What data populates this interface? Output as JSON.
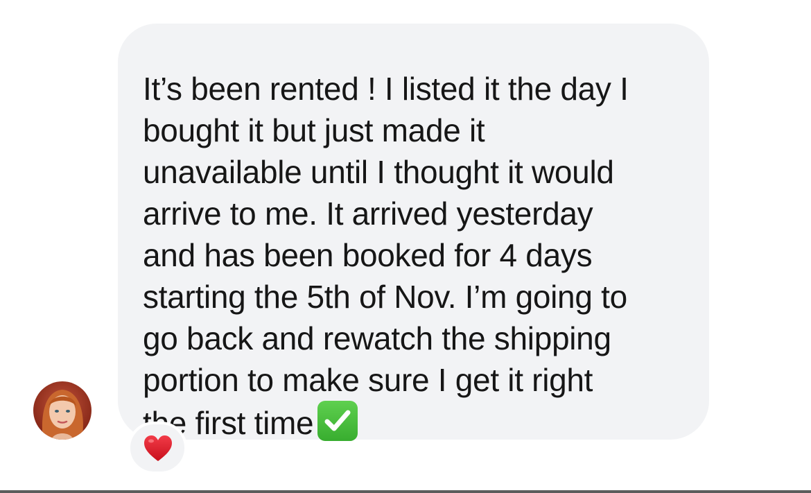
{
  "message": {
    "lines": [
      "It’s been rented ! I listed it the day I",
      "bought it but just made it",
      "unavailable until I thought it would",
      "arrive to me. It arrived yesterday",
      "and has been booked for 4 days",
      "starting the 5th of Nov. I’m going to",
      "go back and rewatch the shipping",
      "portion to make sure I get it right",
      "the first time"
    ],
    "trailing_emoji": "check-mark-button-icon",
    "bubble_color": "#f2f3f5",
    "text_color": "#161616"
  },
  "sender": {
    "avatar": "avatar-icon"
  },
  "reaction": {
    "emoji": "red-heart-icon",
    "color": "#e0202e"
  }
}
